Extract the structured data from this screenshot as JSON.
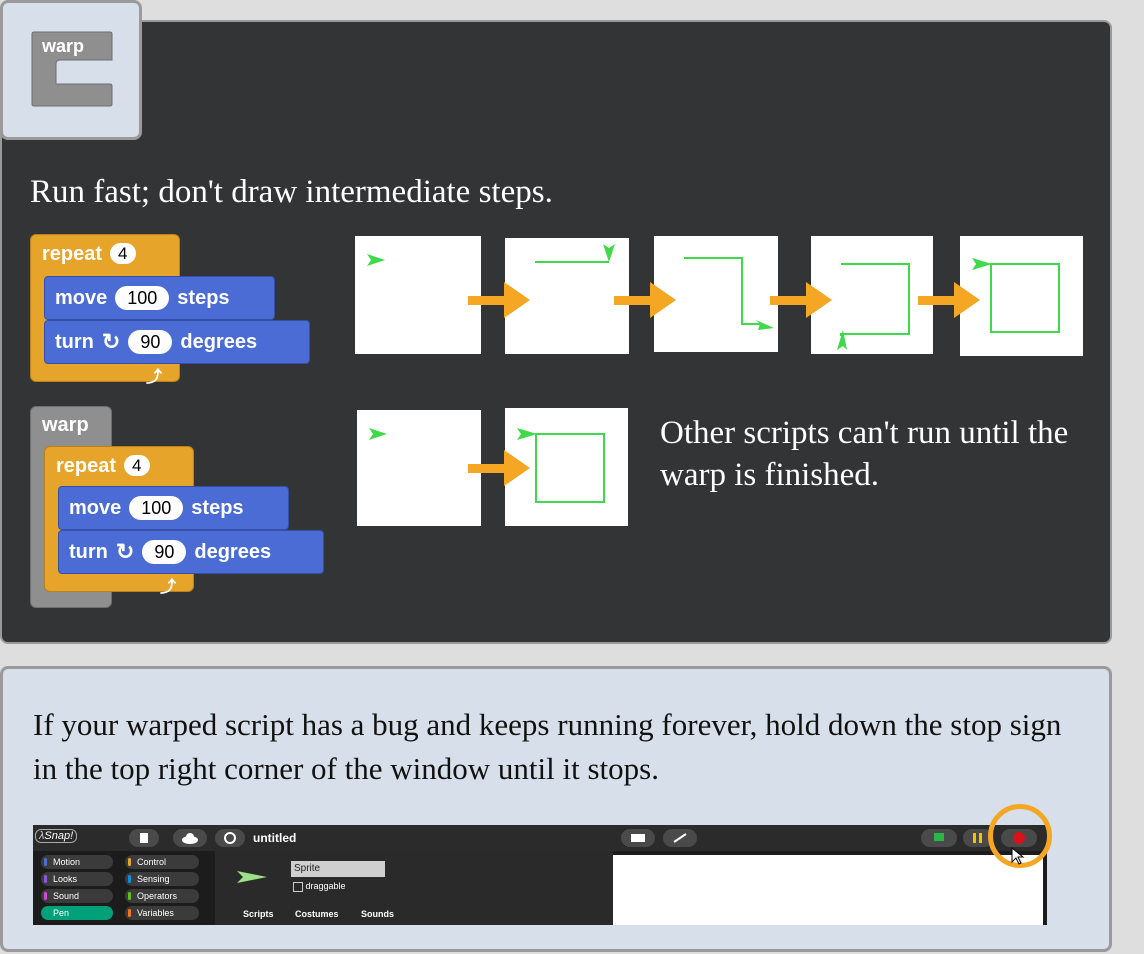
{
  "header_icon": {
    "label": "warp"
  },
  "dark_panel": {
    "heading": "Run fast; don't draw intermediate steps.",
    "example1": {
      "repeat_label": "repeat",
      "repeat_count": "4",
      "move_label": "move",
      "move_value": "100",
      "steps_label": "steps",
      "turn_label": "turn",
      "turn_value": "90",
      "degrees_label": "degrees"
    },
    "example2": {
      "warp_label": "warp",
      "repeat_label": "repeat",
      "repeat_count": "4",
      "move_label": "move",
      "move_value": "100",
      "steps_label": "steps",
      "turn_label": "turn",
      "turn_value": "90",
      "degrees_label": "degrees"
    },
    "note": "Other scripts can't run until the warp is finished.",
    "colors": {
      "sprite": "#3fd94a",
      "arrow": "#f5a623",
      "control": "#e6a52a",
      "motion": "#4a6cd4"
    }
  },
  "bottom_panel": {
    "text": "If your warped script has a bug and keeps running forever, hold down the stop sign in the top right corner of the window until it stops.",
    "snap": {
      "logo": "Snap!",
      "project_name": "untitled",
      "categories": [
        "Motion",
        "Looks",
        "Sound",
        "Pen",
        "Control",
        "Sensing",
        "Operators",
        "Variables"
      ],
      "sprite_name": "Sprite",
      "draggable_label": "draggable",
      "tabs": [
        "Scripts",
        "Costumes",
        "Sounds"
      ],
      "highlight_color": "#f5a623"
    }
  }
}
